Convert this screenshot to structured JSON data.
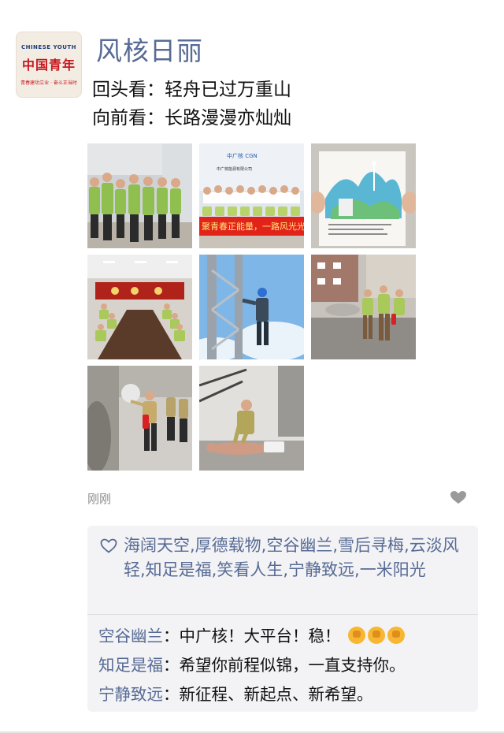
{
  "avatar": {
    "brand_en": "CHINESE YOUTH",
    "brand_cn": "中国青年",
    "slogan": "青春建功立业 · 奋斗正当时"
  },
  "post": {
    "author": "风核日丽",
    "lines": [
      "回头看：轻舟已过万重山",
      "向前看：长路漫漫亦灿灿"
    ],
    "time": "刚刚",
    "photos": [
      {
        "desc": "group-standing-photo",
        "caption": ""
      },
      {
        "desc": "banner-group-photo",
        "caption": "聚青春正能量，一路风光光"
      },
      {
        "desc": "drawing-paper-photo",
        "caption": ""
      },
      {
        "desc": "meeting-room-photo",
        "caption": ""
      },
      {
        "desc": "tower-climb-photo",
        "caption": ""
      },
      {
        "desc": "extinguisher-drill-photo",
        "caption": ""
      },
      {
        "desc": "fire-training-photo",
        "caption": ""
      },
      {
        "desc": "cpr-training-photo",
        "caption": ""
      }
    ]
  },
  "likes": {
    "names": "海阔天空,厚德载物,空谷幽兰,雪后寻梅,云淡风轻,知足是福,笑看人生,宁静致远,一米阳光"
  },
  "comments": [
    {
      "author": "空谷幽兰",
      "text": "中广核！大平台！稳！",
      "emoji_count": 3
    },
    {
      "author": "知足是福",
      "text": "希望你前程似锦，一直支持你。",
      "emoji_count": 0
    },
    {
      "author": "宁静致远",
      "text": "新征程、新起点、新希望。",
      "emoji_count": 0
    }
  ],
  "colors": {
    "link": "#576b95",
    "comment_bg": "#f3f3f5"
  }
}
